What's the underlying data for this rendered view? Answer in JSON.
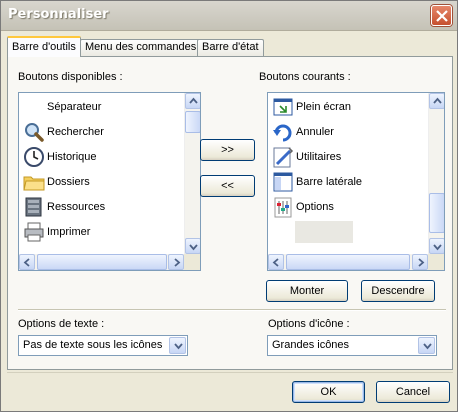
{
  "window": {
    "title": "Personnaliser"
  },
  "tabs": [
    {
      "label": "Barre d'outils",
      "active": true
    },
    {
      "label": "Menu des commandes",
      "active": false
    },
    {
      "label": "Barre d'état",
      "active": false
    }
  ],
  "available": {
    "label": "Boutons disponibles :",
    "items": [
      {
        "label": "Séparateur",
        "icon": "separator-icon"
      },
      {
        "label": "Rechercher",
        "icon": "search-icon"
      },
      {
        "label": "Historique",
        "icon": "history-clock-icon"
      },
      {
        "label": "Dossiers",
        "icon": "folders-icon"
      },
      {
        "label": "Ressources",
        "icon": "resources-icon"
      },
      {
        "label": "Imprimer",
        "icon": "printer-icon"
      }
    ]
  },
  "current": {
    "label": "Boutons courants :",
    "items": [
      {
        "label": "Plein écran",
        "icon": "fullscreen-icon"
      },
      {
        "label": "Annuler",
        "icon": "undo-icon"
      },
      {
        "label": "Utilitaires",
        "icon": "tools-icon"
      },
      {
        "label": "Barre latérale",
        "icon": "sidebar-icon"
      },
      {
        "label": "Options",
        "icon": "options-icon"
      }
    ]
  },
  "buttons": {
    "add": ">>",
    "remove": "<<",
    "move_up": "Monter",
    "move_down": "Descendre",
    "ok": "OK",
    "cancel": "Cancel"
  },
  "text_options": {
    "label": "Options de texte :",
    "value": "Pas de texte sous les icônes"
  },
  "icon_options": {
    "label": "Options d'icône :",
    "value": "Grandes icônes"
  },
  "colors": {
    "accent_tab": "#ffc83c",
    "button_border": "#003c74",
    "list_border": "#7f9db9"
  }
}
